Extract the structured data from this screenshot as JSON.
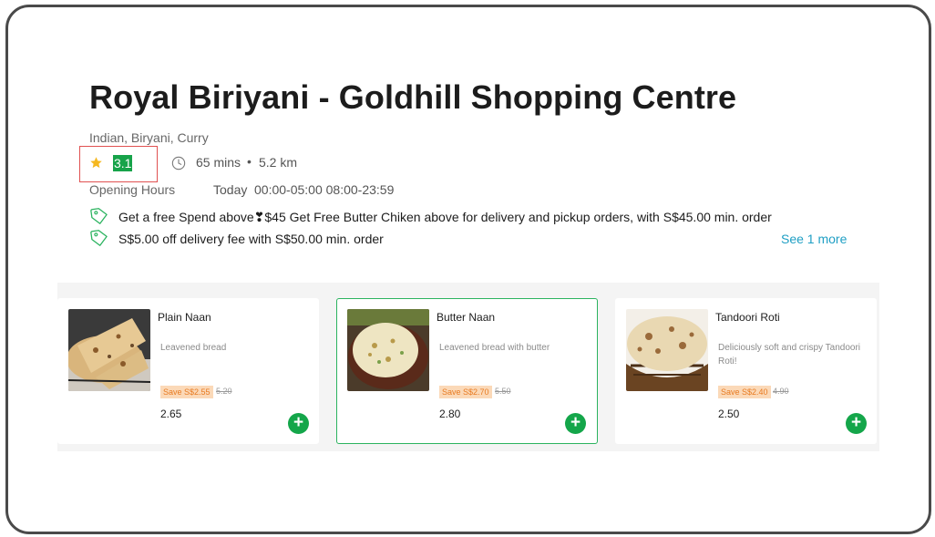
{
  "restaurant": {
    "name": "Royal Biriyani - Goldhill Shopping Centre",
    "cuisines": "Indian, Biryani, Curry",
    "rating": "3.1",
    "eta": "65 mins",
    "separator": "•",
    "distance": "5.2 km",
    "hours_label": "Opening Hours",
    "hours_day": "Today",
    "hours_times": "00:00-05:00 08:00-23:59"
  },
  "promotions": [
    {
      "icon": "tag-icon",
      "text": "Get a free Spend above❣$45 Get Free Butter Chiken above for delivery and pickup orders, with S$45.00 min. order"
    },
    {
      "icon": "tag-icon",
      "text": "S$5.00 off delivery fee with S$50.00 min. order"
    }
  ],
  "see_more_label": "See 1 more",
  "menu_items": [
    {
      "name": "Plain Naan",
      "description": "Leavened bread",
      "save": "Save S$2.55",
      "old_price": "5.20",
      "price": "2.65",
      "add_label": "+"
    },
    {
      "name": "Butter Naan",
      "description": "Leavened bread with butter",
      "save": "Save S$2.70",
      "old_price": "5.50",
      "price": "2.80",
      "add_label": "+"
    },
    {
      "name": "Tandoori Roti",
      "description": "Deliciously soft and crispy Tandoori Roti!",
      "save": "Save S$2.40",
      "old_price": "4.90",
      "price": "2.50",
      "add_label": "+"
    }
  ],
  "colors": {
    "accent_green": "#14a64a",
    "rating_bg": "#17a34a",
    "link_blue": "#1f9fc4",
    "save_badge_bg": "#fbd9b8",
    "save_badge_text": "#e87b22",
    "highlight_box": "#e05151"
  }
}
